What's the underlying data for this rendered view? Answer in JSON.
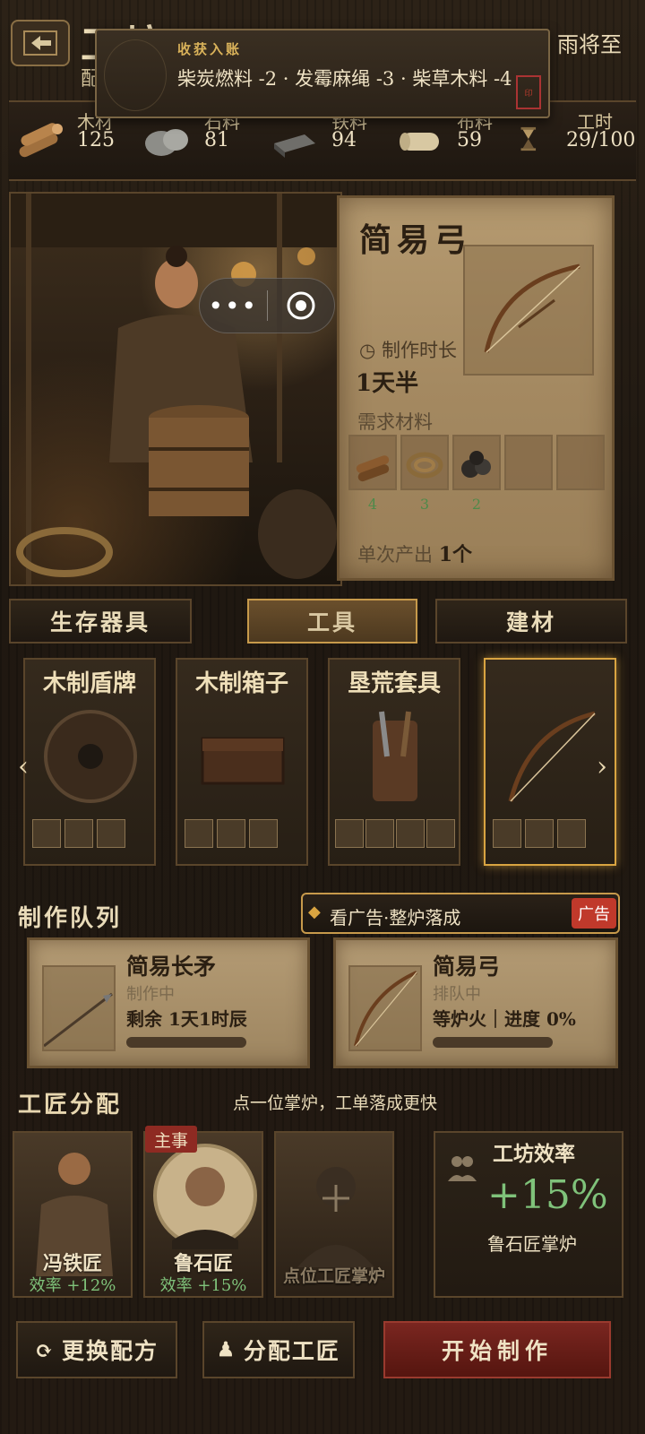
{
  "header": {
    "title": "工坊",
    "subtitle": "配",
    "weather": "雨将至"
  },
  "toast": {
    "title": "收获入账",
    "body": "柴炭燃料 -2 · 发霉麻绳 -3 · 柴草木料 -4"
  },
  "resources": [
    {
      "label": "木材",
      "value": "125",
      "icon": "wood-icon"
    },
    {
      "label": "石料",
      "value": "81",
      "icon": "stone-icon"
    },
    {
      "label": "铁料",
      "value": "94",
      "icon": "iron-icon"
    },
    {
      "label": "布料",
      "value": "59",
      "icon": "cloth-icon"
    },
    {
      "label": "工时",
      "value": "29/100",
      "icon": "hourglass-icon"
    }
  ],
  "mini_controls": {
    "dots": "•••"
  },
  "recipe": {
    "name": "简易弓",
    "time_label": "制作时长",
    "time_value": "1天半",
    "materials_label": "需求材料",
    "materials": [
      {
        "icon": "wood-icon",
        "count": "4"
      },
      {
        "icon": "rope-icon",
        "count": "3"
      },
      {
        "icon": "coal-icon",
        "count": "2"
      }
    ],
    "yield_label": "单次产出",
    "yield_value": "1个"
  },
  "tabs": [
    {
      "label": "生存器具",
      "active": false
    },
    {
      "label": "工具",
      "active": true
    },
    {
      "label": "建材",
      "active": false
    }
  ],
  "items": [
    {
      "name": "木制盾牌",
      "icon": "shield-icon",
      "selected": false
    },
    {
      "name": "木制箱子",
      "icon": "chest-icon",
      "selected": false
    },
    {
      "name": "垦荒套具",
      "icon": "tool-kit-icon",
      "selected": false
    },
    {
      "name": "",
      "icon": "bow-icon",
      "selected": true
    }
  ],
  "queue": {
    "title": "制作队列",
    "ad_text": "看广告·整炉落成",
    "ad_tag": "广告",
    "entries": [
      {
        "name": "简易长矛",
        "status": "制作中",
        "info": "剩余 1天1时辰",
        "progress": 0.0
      },
      {
        "name": "简易弓",
        "status": "排队中",
        "info": "等炉火｜进度 0%",
        "progress": 0.0
      }
    ]
  },
  "artisans": {
    "title": "工匠分配",
    "hint": "点一位掌炉，工单落成更快",
    "chief_tag": "主事",
    "list": [
      {
        "name": "冯铁匠",
        "efficiency": "效率 +12%"
      },
      {
        "name": "鲁石匠",
        "efficiency": "效率 +15%"
      },
      {
        "name": "点位工匠掌炉",
        "efficiency": ""
      }
    ],
    "panel_label": "工坊效率",
    "panel_value": "+15%",
    "panel_note": "鲁石匠掌炉"
  },
  "buttons": {
    "change_recipe": "更换配方",
    "assign": "分配工匠",
    "start": "开始制作"
  },
  "colors": {
    "accent_gold": "#d9a441",
    "positive_green": "#7fc27a",
    "danger_red": "#c0392b"
  }
}
